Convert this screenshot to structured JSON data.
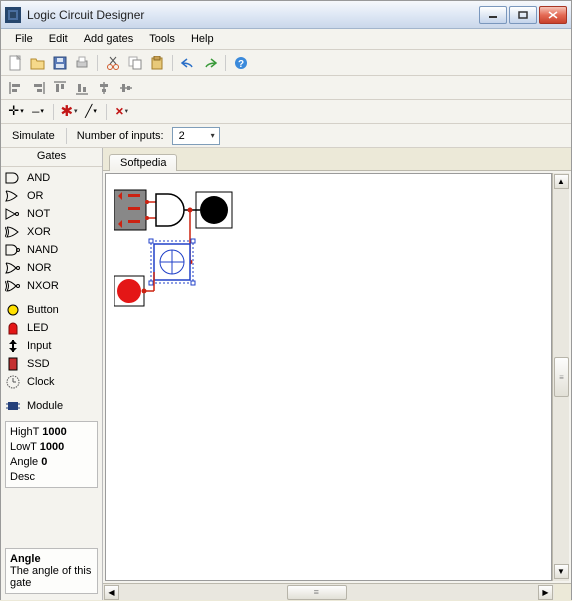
{
  "window": {
    "title": "Logic Circuit Designer"
  },
  "menus": [
    "File",
    "Edit",
    "Add gates",
    "Tools",
    "Help"
  ],
  "toolbar1_icons": [
    {
      "name": "new-icon"
    },
    {
      "name": "open-icon"
    },
    {
      "name": "save-icon"
    },
    {
      "name": "print-icon"
    },
    {
      "sep": true
    },
    {
      "name": "cut-icon"
    },
    {
      "name": "copy-icon"
    },
    {
      "name": "paste-icon"
    },
    {
      "sep": true
    },
    {
      "name": "undo-icon"
    },
    {
      "name": "redo-icon"
    },
    {
      "sep": true
    },
    {
      "name": "help-icon"
    }
  ],
  "toolbar2_icons": [
    {
      "name": "align-left-icon"
    },
    {
      "name": "align-right-icon"
    },
    {
      "name": "align-top-icon"
    },
    {
      "name": "align-bottom-icon"
    },
    {
      "name": "align-center-h-icon"
    },
    {
      "name": "align-center-v-icon"
    }
  ],
  "toolbar3_icons": [
    {
      "name": "pointer-icon"
    },
    {
      "name": "wire-h-icon"
    },
    {
      "name": "wire-v-icon"
    },
    {
      "name": "node-icon"
    },
    {
      "name": "wire-diag-icon"
    },
    {
      "name": "wire-v2-icon"
    },
    {
      "name": "delete-icon"
    }
  ],
  "simulate_label": "Simulate",
  "num_inputs_label": "Number of inputs:",
  "num_inputs_value": "2",
  "side_heading": "Gates",
  "gates": [
    {
      "label": "AND",
      "icon": "and-icon"
    },
    {
      "label": "OR",
      "icon": "or-icon"
    },
    {
      "label": "NOT",
      "icon": "not-icon"
    },
    {
      "label": "XOR",
      "icon": "xor-icon"
    },
    {
      "label": "NAND",
      "icon": "nand-icon"
    },
    {
      "label": "NOR",
      "icon": "nor-icon"
    },
    {
      "label": "NXOR",
      "icon": "nxor-icon"
    },
    {
      "label": "Button",
      "icon": "button-icon"
    },
    {
      "label": "LED",
      "icon": "led-icon"
    },
    {
      "label": "Input",
      "icon": "input-icon"
    },
    {
      "label": "SSD",
      "icon": "ssd-icon"
    },
    {
      "label": "Clock",
      "icon": "clock-icon"
    },
    {
      "label": "Module",
      "icon": "module-icon"
    }
  ],
  "props": {
    "high_label": "HighT",
    "high_val": "1000",
    "low_label": "LowT",
    "low_val": "1000",
    "angle_label": "Angle",
    "angle_val": "0",
    "desc_label": "Desc"
  },
  "explain": {
    "title": "Angle",
    "body": "The angle of this gate"
  },
  "tab_label": "Softpedia"
}
